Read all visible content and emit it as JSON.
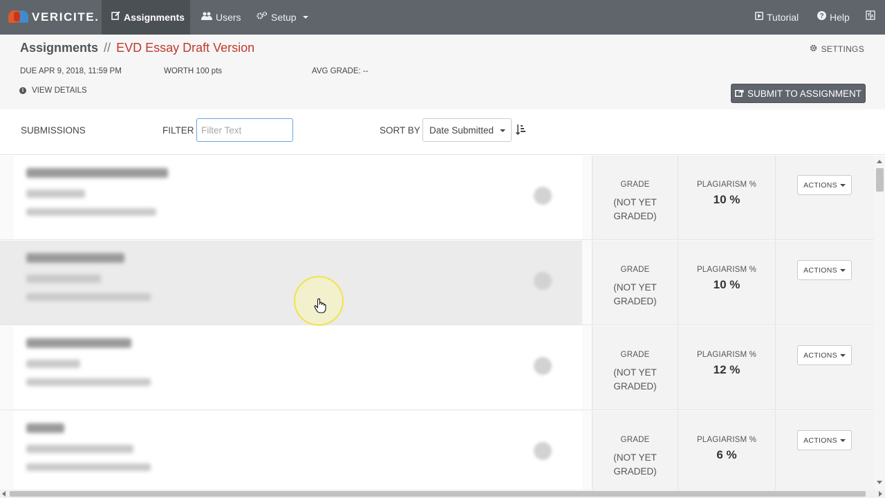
{
  "brand": {
    "name": "VERICITE."
  },
  "nav": {
    "assignments": "Assignments",
    "users": "Users",
    "setup": "Setup",
    "tutorial": "Tutorial",
    "help": "Help"
  },
  "header": {
    "crumb_root": "Assignments",
    "crumb_sep": "//",
    "assignment_title": "EVD Essay Draft Version",
    "settings": "SETTINGS",
    "due": "DUE APR 9, 2018, 11:59 PM",
    "worth": "WORTH 100 pts",
    "avg_grade": "AVG GRADE: --",
    "view_details": "VIEW DETAILS",
    "submit_button": "SUBMIT TO ASSIGNMENT"
  },
  "toolbar": {
    "submissions_label": "SUBMISSIONS",
    "filter_label": "FILTER",
    "filter_placeholder": "Filter Text",
    "sort_label": "SORT BY",
    "sort_value": "Date Submitted"
  },
  "submissions": [
    {
      "grade_label": "GRADE",
      "grade_line1": "(NOT YET",
      "grade_line2": "GRADED)",
      "plag_label": "PLAGIARISM %",
      "plag_value": "10 %",
      "actions_label": "ACTIONS"
    },
    {
      "grade_label": "GRADE",
      "grade_line1": "(NOT YET",
      "grade_line2": "GRADED)",
      "plag_label": "PLAGIARISM %",
      "plag_value": "10 %",
      "actions_label": "ACTIONS"
    },
    {
      "grade_label": "GRADE",
      "grade_line1": "(NOT YET",
      "grade_line2": "GRADED)",
      "plag_label": "PLAGIARISM %",
      "plag_value": "12 %",
      "actions_label": "ACTIONS"
    },
    {
      "grade_label": "GRADE",
      "grade_line1": "(NOT YET",
      "grade_line2": "GRADED)",
      "plag_label": "PLAGIARISM %",
      "plag_value": "6 %",
      "actions_label": "ACTIONS"
    }
  ],
  "colors": {
    "nav_bg": "#5f656b",
    "accent_title": "#c0392b",
    "focus_border": "#66a3e6"
  }
}
